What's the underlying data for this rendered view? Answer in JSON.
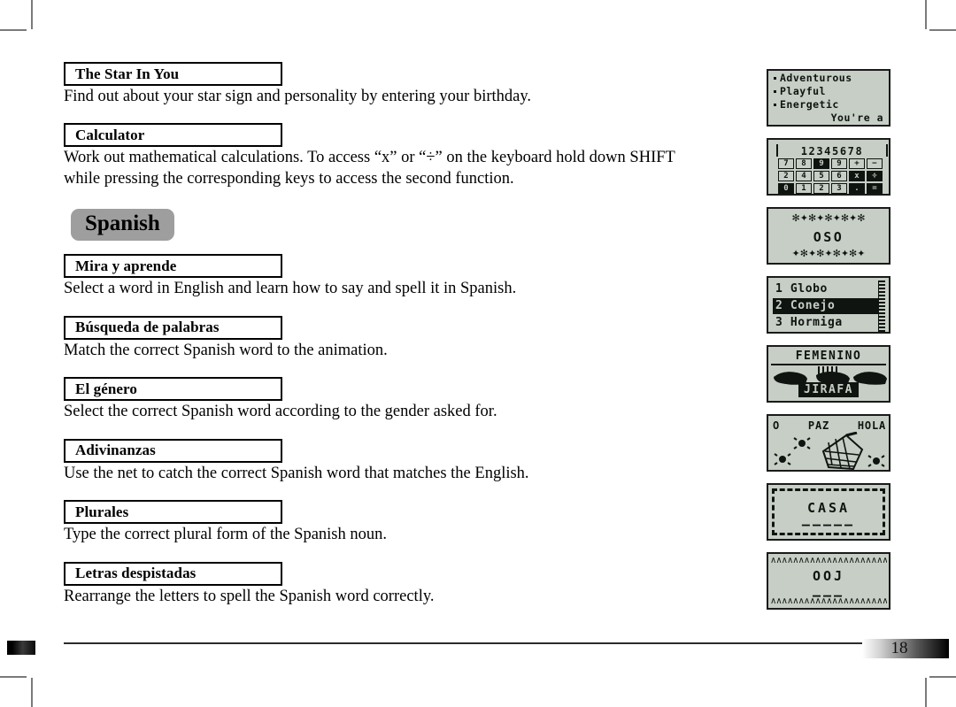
{
  "page": {
    "number": "18"
  },
  "entries": [
    {
      "title": "The Star In You",
      "description": "Find out about your star sign and personality by entering your birthday."
    },
    {
      "title": "Calculator",
      "description": "Work out mathematical calculations. To access “x” or “÷” on the keyboard hold down SHIFT while pressing the corresponding keys to access the second function."
    }
  ],
  "section": {
    "label": "Spanish"
  },
  "spanish_entries": [
    {
      "title": "Mira y aprende",
      "description": "Select a word in English and learn how to say and spell it in Spanish."
    },
    {
      "title": "Búsqueda de palabras",
      "description": "Match the correct Spanish word to the animation."
    },
    {
      "title": "El género",
      "description": "Select the correct Spanish word according to the gender asked for."
    },
    {
      "title": "Adivinanzas",
      "description": "Use the net to catch the correct Spanish word that matches the English."
    },
    {
      "title": "Plurales",
      "description": "Type the correct plural form of the Spanish noun."
    },
    {
      "title": "Letras despistadas",
      "description": "Rearrange the letters to spell the Spanish word correctly."
    }
  ],
  "screens": [
    {
      "name": "star-in-you-screen",
      "lines": [
        "Adventurous",
        "Playful",
        "Energetic"
      ],
      "footer": "You're a"
    },
    {
      "name": "calculator-screen",
      "display": "12345678",
      "keys": [
        [
          "7",
          "8",
          "9",
          "9",
          "+",
          "−"
        ],
        [
          "2",
          "4",
          "5",
          "6",
          "x",
          "÷"
        ],
        [
          "0",
          "1",
          "2",
          "3",
          ".",
          "="
        ]
      ],
      "inverted_keys": [
        "r0c2",
        "r1c4",
        "r1c5",
        "r2c0",
        "r2c4",
        "r2c5"
      ]
    },
    {
      "name": "mira-y-aprende-screen",
      "word": "OSO",
      "border_top": "✻✦✻✦✻✦✻✦✻",
      "border_bottom": "✦✻✦✻✦✻✦✻✦"
    },
    {
      "name": "busqueda-de-palabras-screen",
      "items": [
        {
          "label": "1 Globo",
          "selected": false
        },
        {
          "label": "2 Conejo",
          "selected": true
        },
        {
          "label": "3 Hormiga",
          "selected": false
        }
      ]
    },
    {
      "name": "el-genero-screen",
      "title": "FEMENINO",
      "answer": "JIRAFA"
    },
    {
      "name": "adivinanzas-screen",
      "words": [
        "O",
        "PAZ",
        "HOLA"
      ]
    },
    {
      "name": "plurales-screen",
      "word": "CASA",
      "blanks": "—————"
    },
    {
      "name": "letras-despistadas-screen",
      "word": "OOJ",
      "blanks": "———",
      "border": "∧∧∧∧∧∧∧∧∧∧∧∧∧∧∧∧∧∧∧∧∧∧∧∧"
    }
  ]
}
